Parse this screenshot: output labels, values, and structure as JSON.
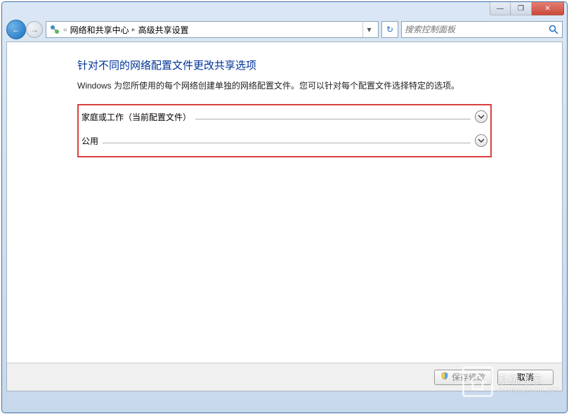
{
  "window": {
    "controls": {
      "minimize": "—",
      "maximize": "❐",
      "close": "✕"
    }
  },
  "nav": {
    "back_arrow": "←",
    "fwd_arrow": "→",
    "chevron": "«",
    "crumb1": "网络和共享中心",
    "sep": "▸",
    "crumb2": "高级共享设置",
    "dropdown": "▾",
    "refresh": "↻"
  },
  "search": {
    "placeholder": "搜索控制面板"
  },
  "content": {
    "title": "针对不同的网络配置文件更改共享选项",
    "description": "Windows 为您所使用的每个网络创建单独的网络配置文件。您可以针对每个配置文件选择特定的选项。",
    "profiles": [
      {
        "label": "家庭或工作（当前配置文件）"
      },
      {
        "label": "公用"
      }
    ]
  },
  "footer": {
    "save": "保存修改",
    "cancel": "取消"
  },
  "watermark": {
    "title": "系统之家",
    "sub": "XITONGZHIJIA.NET"
  }
}
